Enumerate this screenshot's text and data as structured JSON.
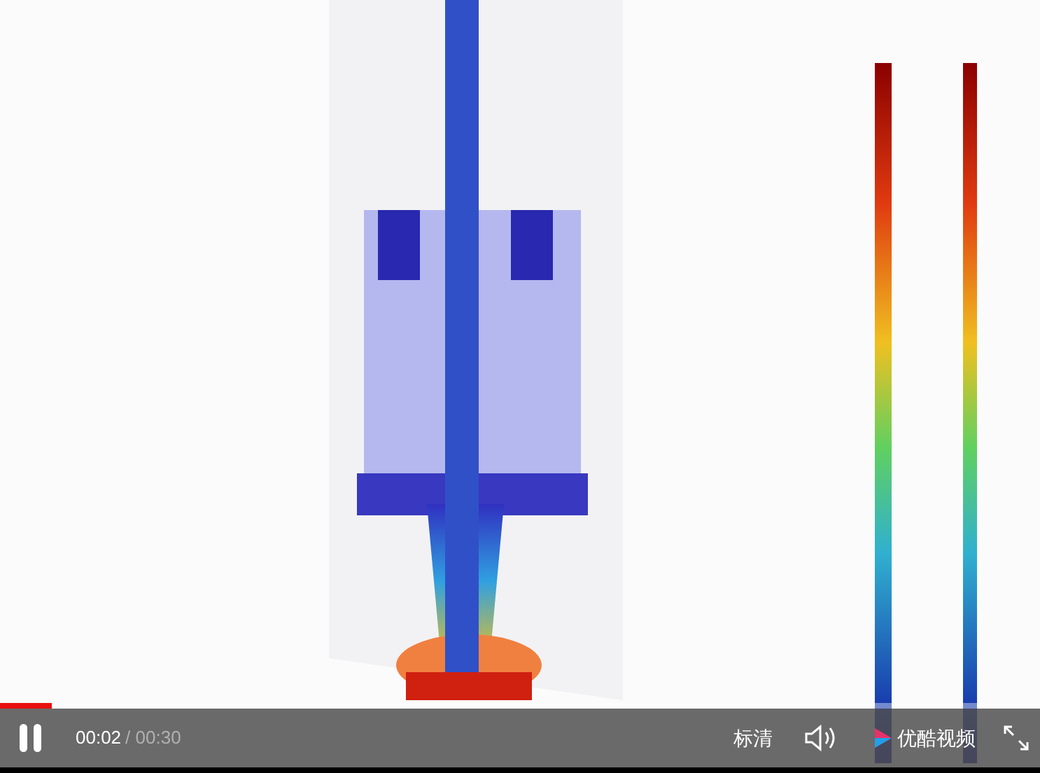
{
  "player": {
    "playing": true,
    "progress": {
      "level": 0.05
    },
    "current_time": "00:02",
    "duration": "/ 00:30",
    "quality": "标清",
    "brand": "优酷视频"
  }
}
